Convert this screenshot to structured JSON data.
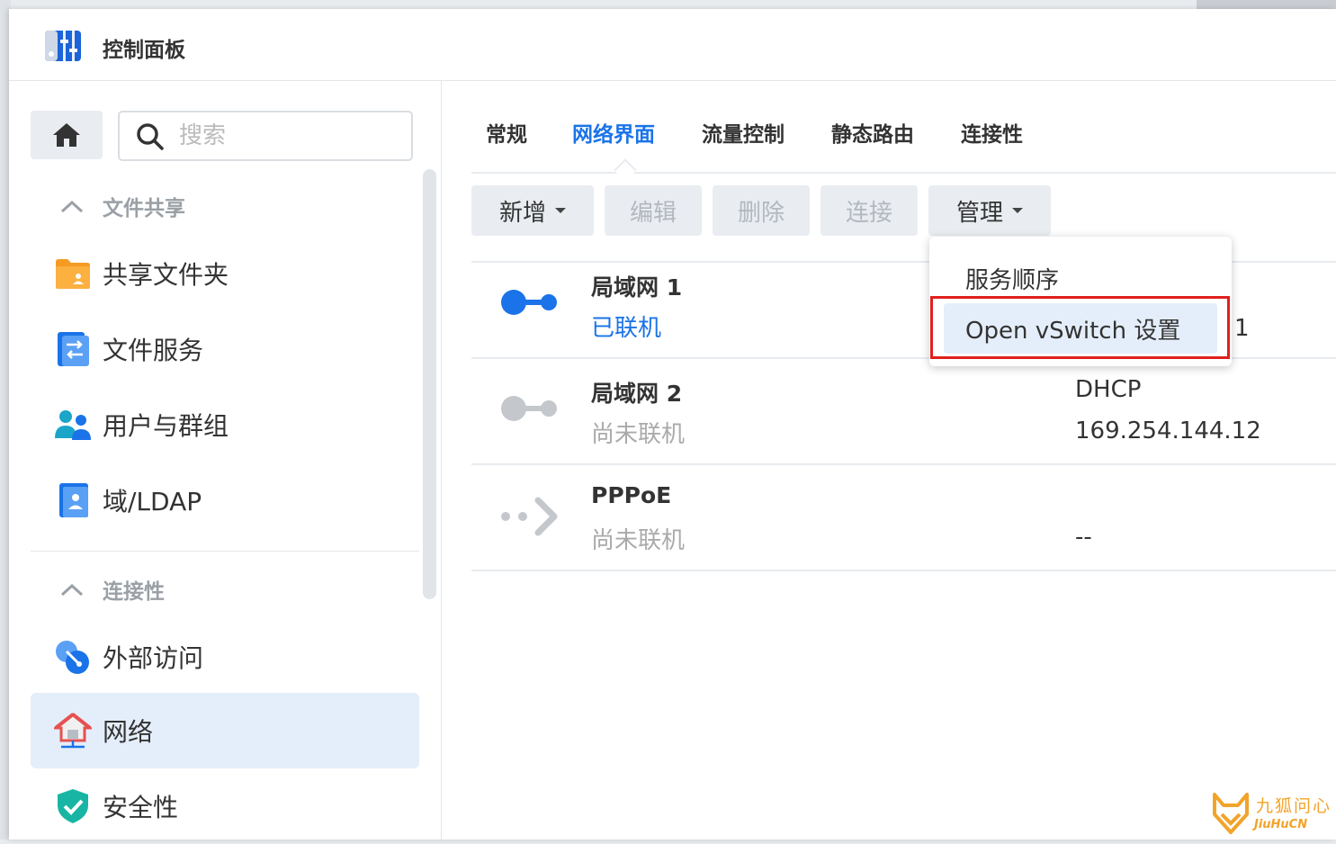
{
  "window": {
    "title": "控制面板"
  },
  "sidebar": {
    "search_placeholder": "搜索",
    "sections": [
      {
        "title": "文件共享",
        "items": [
          {
            "label": "共享文件夹",
            "icon": "shared-folder-icon"
          },
          {
            "label": "文件服务",
            "icon": "file-services-icon"
          },
          {
            "label": "用户与群组",
            "icon": "users-groups-icon"
          },
          {
            "label": "域/LDAP",
            "icon": "domain-ldap-icon"
          }
        ]
      },
      {
        "title": "连接性",
        "items": [
          {
            "label": "外部访问",
            "icon": "external-access-icon"
          },
          {
            "label": "网络",
            "icon": "network-icon",
            "active": true
          },
          {
            "label": "安全性",
            "icon": "security-shield-icon"
          }
        ]
      }
    ]
  },
  "tabs": [
    {
      "label": "常规"
    },
    {
      "label": "网络界面",
      "active": true
    },
    {
      "label": "流量控制"
    },
    {
      "label": "静态路由"
    },
    {
      "label": "连接性"
    }
  ],
  "toolbar": {
    "create": "新增",
    "edit": "编辑",
    "delete": "删除",
    "connect": "连接",
    "manage": "管理"
  },
  "interfaces": [
    {
      "name": "局域网 1",
      "status": "已联机",
      "connected": true,
      "info1": "",
      "info2": "1"
    },
    {
      "name": "局域网 2",
      "status": "尚未联机",
      "connected": false,
      "info1": "DHCP",
      "info2": "169.254.144.12"
    },
    {
      "name": "PPPoE",
      "status": "尚未联机",
      "connected": false,
      "info1": "",
      "info2": "--"
    }
  ],
  "manage_menu": {
    "items": [
      {
        "label": "服务顺序"
      },
      {
        "label": "Open vSwitch 设置",
        "highlighted": true
      }
    ]
  },
  "watermark": {
    "text": "九狐问心",
    "sub": "JiuHuCN"
  },
  "colors": {
    "accent": "#1a73e8",
    "highlight_box": "#e0201d",
    "active_bg": "#e4eefa"
  }
}
